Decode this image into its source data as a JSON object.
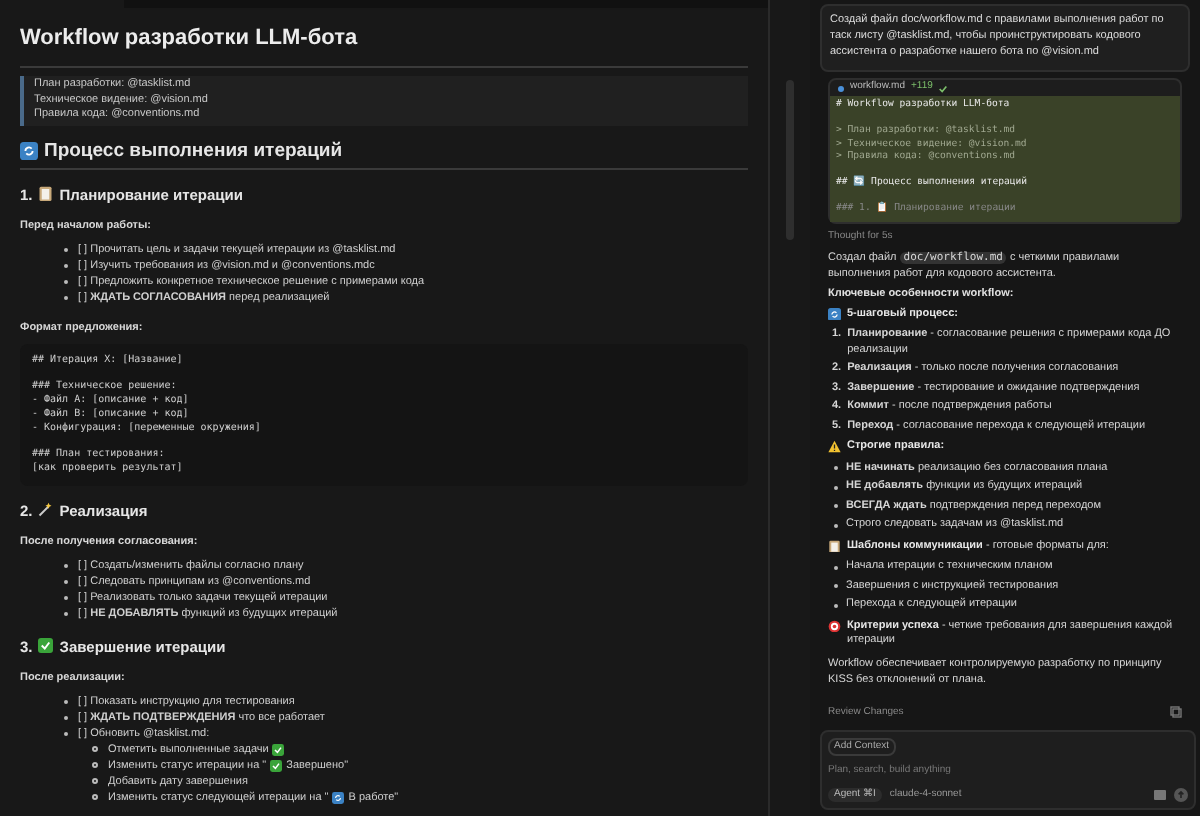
{
  "preview": {
    "title": "Workflow разработки LLM-бота",
    "quote": [
      "План разработки: @tasklist.md",
      "Техническое видение: @vision.md",
      "Правила кода: @conventions.md"
    ],
    "blocks": [
      {
        "kind": "h2",
        "text": "Процесс выполнения итераций"
      },
      {
        "kind": "h3",
        "prefix": "1.",
        "text": "Планирование итерации"
      },
      {
        "kind": "label",
        "text": "Перед началом работы:"
      },
      {
        "kind": "list",
        "items": [
          {
            "text": "[ ] Прочитать цель и задачи текущей итерации из @tasklist.md"
          },
          {
            "text": "[ ] Изучить требования из @vision.md и @conventions.mdc"
          },
          {
            "text": "[ ] Предложить конкретное техническое решение с примерами кода"
          },
          {
            "text": "[ ] **ЖДАТЬ СОГЛАСОВАНИЯ** перед реализацией"
          }
        ]
      },
      {
        "kind": "label",
        "text": "Формат предложения:"
      },
      {
        "kind": "code",
        "groups": [
          [
            "## Итерация X: [Название]"
          ],
          [
            "### Техническое решение:",
            "- Файл A: [описание + код]",
            "- Файл B: [описание + код]",
            "- Конфигурация: [переменные окружения]"
          ],
          [
            "### План тестирования:",
            "[как проверить результат]"
          ]
        ]
      },
      {
        "kind": "h3",
        "prefix": "2.",
        "text": "Реализация"
      },
      {
        "kind": "label",
        "text": "После получения согласования:"
      },
      {
        "kind": "list",
        "items": [
          {
            "text": "[ ] Создать/изменить файлы согласно плану"
          },
          {
            "text": "[ ] Следовать принципам из @conventions.md"
          },
          {
            "text": "[ ] Реализовать только задачи текущей итерации"
          },
          {
            "text": "[ ] **НЕ ДОБАВЛЯТЬ** функций из будущих итераций"
          }
        ]
      },
      {
        "kind": "h3",
        "prefix": "3.",
        "text": "Завершение итерации"
      },
      {
        "kind": "label",
        "text": "После реализации:"
      },
      {
        "kind": "list",
        "items": [
          {
            "text": "[ ] Показать инструкцию для тестирования"
          },
          {
            "text": "[ ] **ЖДАТЬ ПОДТВЕРЖДЕНИЯ** что все работает"
          },
          {
            "text": "[ ] Обновить @tasklist.md:",
            "children": [
              {
                "before": "Отметить выполненные задачи"
              },
              {
                "before": "Изменить статус итерации на \"",
                "after": "Завершено\""
              },
              {
                "before": "Добавить дату завершения"
              },
              {
                "before": "Изменить статус следующей итерации на \"",
                "after": "В работе\""
              }
            ]
          }
        ]
      }
    ]
  },
  "chat": {
    "user_message": "Создай файл doc/workflow.md с правилами выполнения работ по таск листу @tasklist.md, чтобы проинструктировать кодового ассистента о разработке нашего бота по @vision.md",
    "diff": {
      "file": "workflow.md",
      "added": "+119",
      "groups": [
        [
          {
            "text": "# Workflow разработки LLM-бота",
            "kind": "heading"
          }
        ],
        [
          {
            "text": "> План разработки: @tasklist.md",
            "kind": "quote"
          },
          {
            "text": "> Техническое видение: @vision.md",
            "kind": "quote"
          },
          {
            "text": "> Правила кода: @conventions.md",
            "kind": "quote"
          }
        ],
        [
          {
            "text": "## 🔄 Процесс выполнения итераций",
            "kind": "heading"
          }
        ],
        [
          {
            "text": "### 1. 📋 Планирование итерации",
            "kind": "fade"
          }
        ]
      ]
    },
    "thought": "Thought for 5s",
    "reply": [
      {
        "kind": "para",
        "parts": [
          {
            "text": "Создал файл "
          },
          {
            "code": "doc/workflow.md"
          },
          {
            "text": " с четкими правилами выполнения работ для кодового ассистента."
          }
        ]
      },
      {
        "kind": "bold",
        "text": "Ключевые особенности workflow:"
      },
      {
        "kind": "section",
        "head": "5-шаговый процесс:"
      },
      {
        "kind": "olist",
        "items": [
          {
            "number": "1.",
            "text": "**Планирование** - согласование решения с примерами кода ДО реализации"
          },
          {
            "number": "2.",
            "text": "**Реализация** - только после получения согласования"
          },
          {
            "number": "3.",
            "text": "**Завершение** - тестирование и ожидание подтверждения"
          },
          {
            "number": "4.",
            "text": "**Коммит** - после подтверждения работы"
          },
          {
            "number": "5.",
            "text": "**Переход** - согласование перехода к следующей итерации"
          }
        ]
      },
      {
        "kind": "section",
        "head": "Строгие правила:"
      },
      {
        "kind": "ulist",
        "items": [
          "**НЕ начинать** реализацию без согласования плана",
          "**НЕ добавлять** функции из будущих итераций",
          "**ВСЕГДА ждать** подтверждения перед переходом",
          "Строго следовать задачам из @tasklist.md"
        ]
      },
      {
        "kind": "section",
        "head": "Шаблоны коммуникации",
        "tail": " - готовые форматы для:"
      },
      {
        "kind": "ulist",
        "items": [
          "Начала итерации с техническим планом",
          "Завершения с инструкцией тестирования",
          "Перехода к следующей итерации"
        ]
      },
      {
        "kind": "section",
        "head": "Критерии успеха",
        "tail": " - четкие требования для завершения каждой итерации"
      },
      {
        "kind": "plain",
        "text": "Workflow обеспечивает контролируемую разработку по принципу KISS без отклонений от плана."
      }
    ],
    "review": "Review Changes",
    "input": {
      "context": "Add Context",
      "placeholder": "Plan, search, build anything",
      "mode": "Agent",
      "shortcut": "⌘I",
      "model": "claude-4-sonnet"
    }
  }
}
